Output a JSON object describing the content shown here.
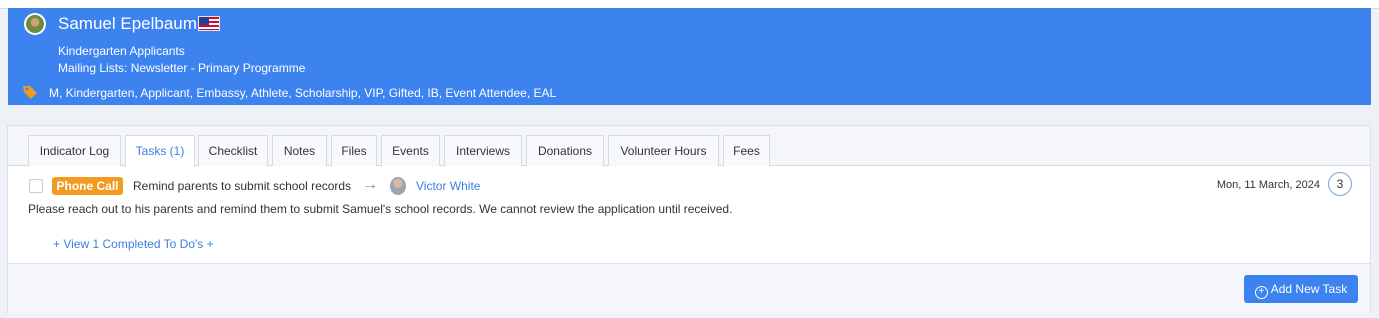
{
  "contact": {
    "name": "Samuel Epelbaum",
    "group": "Kindergarten Applicants",
    "mailing_lists": "Mailing Lists: Newsletter - Primary Programme",
    "tags": "M, Kindergarten, Applicant, Embassy, Athlete, Scholarship, VIP, Gifted, IB, Event Attendee, EAL"
  },
  "tabs": [
    {
      "label": "Indicator Log"
    },
    {
      "label": "Tasks (1)"
    },
    {
      "label": "Checklist"
    },
    {
      "label": "Notes"
    },
    {
      "label": "Files"
    },
    {
      "label": "Events"
    },
    {
      "label": "Interviews"
    },
    {
      "label": "Donations"
    },
    {
      "label": "Volunteer Hours"
    },
    {
      "label": "Fees"
    }
  ],
  "task": {
    "type": "Phone Call",
    "title": "Remind parents to submit school records",
    "assignee": "Victor White",
    "date": "Mon, 11 March, 2024",
    "comments": "3",
    "description": "Please reach out to his parents and remind them to submit Samuel's school records. We cannot review the application until received."
  },
  "view_completed": "+ View 1 Completed To Do's +",
  "add_button": "Add New Task",
  "colors": {
    "header": "#3d83f0",
    "badge": "#f39b21",
    "link": "#3d7fe0"
  }
}
